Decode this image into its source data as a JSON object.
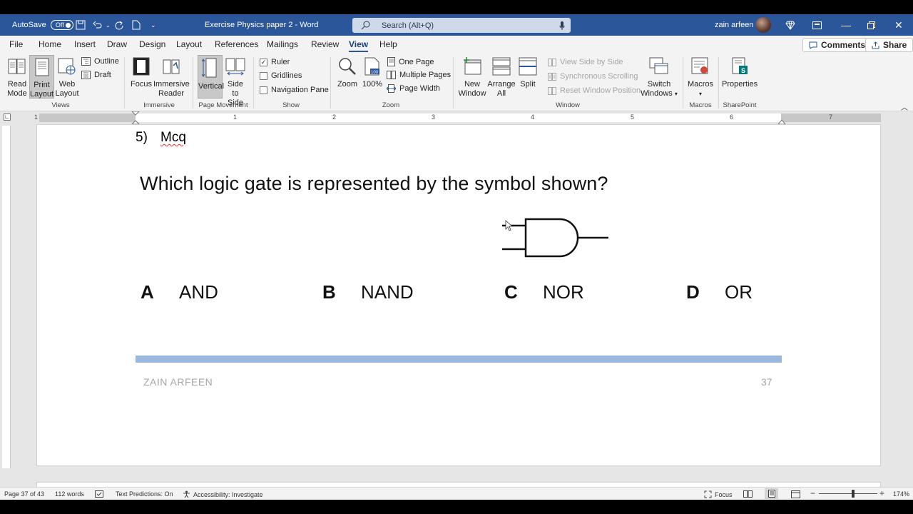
{
  "titlebar": {
    "autosave_label": "AutoSave",
    "autosave_state": "Off",
    "doc_title": "Exercise Physics paper 2  -  Word",
    "search_placeholder": "Search (Alt+Q)",
    "user_name": "zain arfeen"
  },
  "tabs": [
    "File",
    "Home",
    "Insert",
    "Draw",
    "Design",
    "Layout",
    "References",
    "Mailings",
    "Review",
    "View",
    "Help"
  ],
  "active_tab": "View",
  "actions": {
    "comments": "Comments",
    "share": "Share"
  },
  "ribbon": {
    "views": {
      "read_mode": [
        "Read",
        "Mode"
      ],
      "print_layout": [
        "Print",
        "Layout"
      ],
      "web_layout": [
        "Web",
        "Layout"
      ],
      "outline": "Outline",
      "draft": "Draft",
      "group": "Views"
    },
    "immersive": {
      "focus": "Focus",
      "reader": [
        "Immersive",
        "Reader"
      ],
      "group": "Immersive"
    },
    "movement": {
      "vertical": "Vertical",
      "side": [
        "Side",
        "to Side"
      ],
      "group": "Page Movement"
    },
    "show": {
      "ruler": "Ruler",
      "gridlines": "Gridlines",
      "nav": "Navigation Pane",
      "group": "Show",
      "ruler_checked": true
    },
    "zoom": {
      "zoom": "Zoom",
      "hundred": "100%",
      "one_page": "One Page",
      "multi": "Multiple Pages",
      "width": "Page Width",
      "group": "Zoom"
    },
    "window": {
      "new": [
        "New",
        "Window"
      ],
      "arrange": [
        "Arrange",
        "All"
      ],
      "split": "Split",
      "side_by_side": "View Side by Side",
      "sync": "Synchronous Scrolling",
      "reset": "Reset Window Position",
      "switch": [
        "Switch",
        "Windows"
      ],
      "group": "Window"
    },
    "macros": {
      "label": "Macros",
      "group": "Macros"
    },
    "sharepoint": {
      "label": "Properties",
      "group": "SharePoint"
    }
  },
  "ruler_numbers": [
    "1",
    "1",
    "2",
    "3",
    "4",
    "5",
    "6",
    "7"
  ],
  "document": {
    "question_number": "5)",
    "section_label": "Mcq",
    "question": "Which logic gate is represented by the symbol shown?",
    "options": [
      {
        "letter": "A",
        "text": "AND"
      },
      {
        "letter": "B",
        "text": "NAND"
      },
      {
        "letter": "C",
        "text": "NOR"
      },
      {
        "letter": "D",
        "text": "OR"
      }
    ],
    "footer_name": "ZAIN ARFEEN",
    "footer_page": "37"
  },
  "statusbar": {
    "page": "Page 37 of 43",
    "words": "112 words",
    "predictions": "Text Predictions: On",
    "accessibility": "Accessibility: Investigate",
    "focus": "Focus",
    "zoom": "174%"
  },
  "colors": {
    "brand": "#2b579a",
    "footer_bar": "#9ab7de"
  }
}
